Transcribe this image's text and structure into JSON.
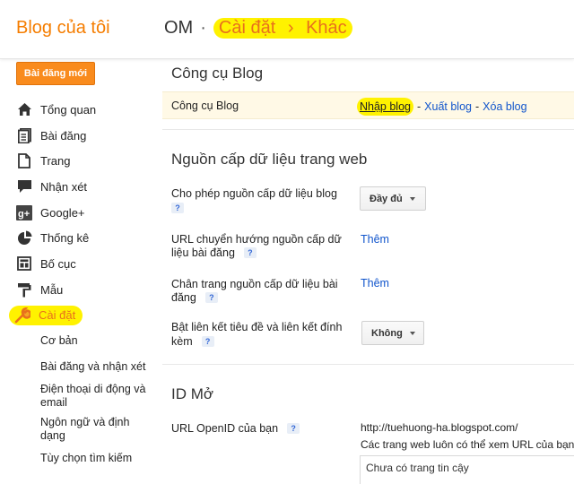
{
  "header": {
    "brand": "Blog của tôi",
    "blog_name": "OM",
    "dot": "·",
    "crumb_settings": "Cài đặt",
    "crumb_arrow": "›",
    "crumb_other": "Khác"
  },
  "sidebar": {
    "new_post": "Bài đăng mới",
    "items": [
      {
        "label": "Tổng quan",
        "icon": "home-icon"
      },
      {
        "label": "Bài đăng",
        "icon": "posts-icon"
      },
      {
        "label": "Trang",
        "icon": "page-icon"
      },
      {
        "label": "Nhận xét",
        "icon": "comment-icon"
      },
      {
        "label": "Google+",
        "icon": "google-plus-icon"
      },
      {
        "label": "Thống kê",
        "icon": "stats-icon"
      },
      {
        "label": "Bố cục",
        "icon": "layout-icon"
      },
      {
        "label": "Mẫu",
        "icon": "template-icon"
      },
      {
        "label": "Cài đặt",
        "icon": "wrench-icon"
      }
    ],
    "sub_items": [
      "Cơ bản",
      "Bài đăng và nhận xét",
      "Điện thoại di động và email",
      "Ngôn ngữ và định dạng",
      "Tùy chọn tìm kiếm"
    ]
  },
  "main": {
    "tools": {
      "title": "Công cụ Blog",
      "row_label": "Công cụ Blog",
      "import": "Nhập blog",
      "export": "Xuất blog",
      "delete": "Xóa blog",
      "dash": "-"
    },
    "feed": {
      "title": "Nguồn cấp dữ liệu trang web",
      "allow_label": "Cho phép nguồn cấp dữ liệu blog",
      "allow_value": "Đầy đủ",
      "redirect_label_1": "URL chuyển hướng nguồn cấp dữ",
      "redirect_label_2": "liệu bài đăng",
      "redirect_action": "Thêm",
      "footer_label_1": "Chân trang nguồn cấp dữ liệu bài",
      "footer_label_2": "đăng",
      "footer_action": "Thêm",
      "enclosure_label_1": "Bật liên kết tiêu đề và liên kết đính",
      "enclosure_label_2": "kèm",
      "enclosure_value": "Không",
      "help": "?"
    },
    "openid": {
      "title": "ID Mở",
      "url_label": "URL OpenID của bạn",
      "url_value": "http://tuehuong-ha.blogspot.com/",
      "trusted_text": "Các trang web luôn có thể xem URL của bạn",
      "trusted_box": "Chưa có trang tin cậy"
    }
  }
}
